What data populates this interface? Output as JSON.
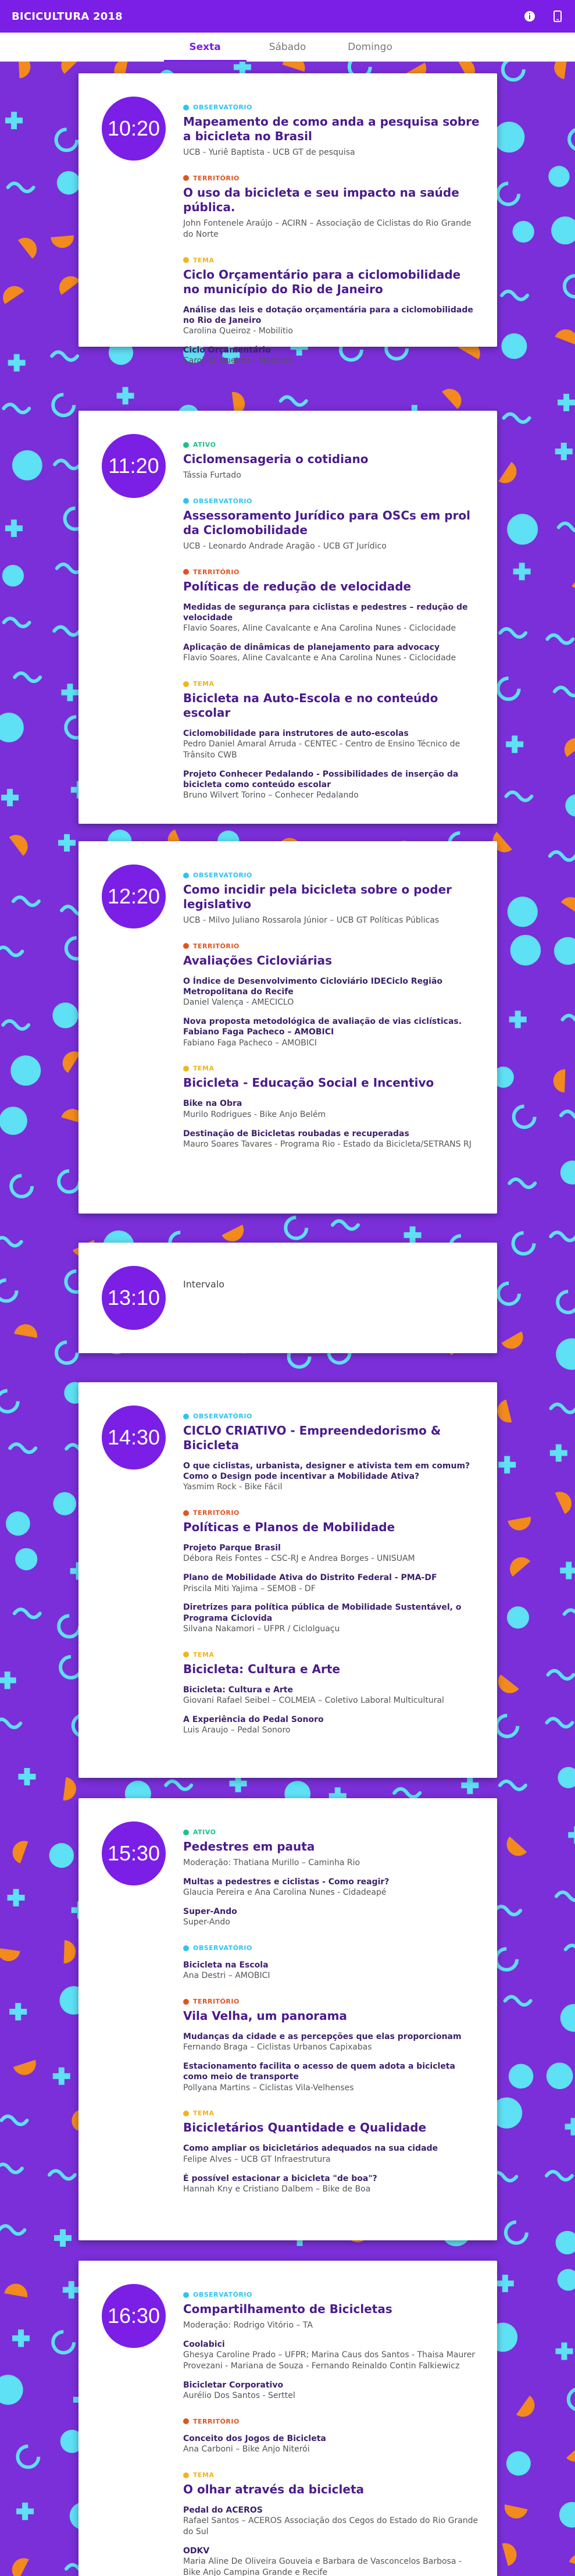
{
  "appbar": {
    "title": "BICICULTURA 2018",
    "info_icon": "info-icon",
    "phone_icon": "phone-icon"
  },
  "tabs": [
    "Sexta",
    "Sábado",
    "Domingo"
  ],
  "colors": {
    "primary": "#7b1ee6",
    "background": "#7a2fd8",
    "cyan": "#5ee0f5",
    "orange": "#f28a1d",
    "observatorio": "#2fc4f0",
    "ativo": "#19c28b",
    "territorio": "#e0541f",
    "tema": "#f2b41a"
  },
  "sessions": [
    {
      "time": "10:20",
      "slots": [
        {
          "type": "OBSERVATÓRIO",
          "title": "Mapeamento de como anda a pesquisa sobre a bicicleta no Brasil",
          "sub": "UCB - Yuriê Baptista - UCB GT de pesquisa",
          "talks": []
        },
        {
          "type": "TERRITÓRIO",
          "title": "O uso da bicicleta e seu impacto na saúde pública.",
          "sub": "John Fontenele Araújo – ACIRN – Associação de Ciclistas do Rio Grande do Norte",
          "talks": []
        },
        {
          "type": "TEMA",
          "title": "Ciclo Orçamentário para a ciclomobilidade no município do Rio de Janeiro",
          "sub": "",
          "talks": [
            {
              "title": "Análise das leis e dotação orçamentária para a ciclomobilidade no Rio de Janeiro",
              "author": "Carolina Queiroz - Mobilitio"
            },
            {
              "title": "Ciclo Orçamentário",
              "author": "Carolina Queiroz - Mobilitio"
            }
          ]
        }
      ]
    },
    {
      "time": "11:20",
      "slots": [
        {
          "type": "ATIVO",
          "title": "Ciclomensageria o cotidiano",
          "sub": "Tássia Furtado",
          "talks": []
        },
        {
          "type": "OBSERVATÓRIO",
          "title": "Assessoramento Jurídico para OSCs em prol da Ciclomobilidade",
          "sub": "UCB - Leonardo Andrade Aragão - UCB GT Jurídico",
          "talks": []
        },
        {
          "type": "TERRITÓRIO",
          "title": "Políticas de redução de velocidade",
          "sub": "",
          "talks": [
            {
              "title": "Medidas de segurança para ciclistas e pedestres – redução de velocidade",
              "author": "Flavio Soares, Aline Cavalcante e Ana Carolina Nunes - Ciclocidade"
            },
            {
              "title": "Aplicação de dinâmicas de planejamento para advocacy",
              "author": "Flavio Soares, Aline Cavalcante e Ana Carolina Nunes - Ciclocidade"
            }
          ]
        },
        {
          "type": "TEMA",
          "title": "Bicicleta na Auto-Escola e no conteúdo escolar",
          "sub": "",
          "talks": [
            {
              "title": "Ciclomobilidade para instrutores de auto-escolas",
              "author": "Pedro Daniel Amaral Arruda - CENTEC - Centro de Ensino Técnico de Trânsito CWB"
            },
            {
              "title": "Projeto Conhecer Pedalando - Possibilidades de inserção da bicicleta como conteúdo escolar",
              "author": "Bruno Wilvert Torino – Conhecer Pedalando"
            }
          ]
        }
      ]
    },
    {
      "time": "12:20",
      "slots": [
        {
          "type": "OBSERVATÓRIO",
          "title": "Como incidir pela bicicleta sobre o poder legislativo",
          "sub": "UCB - Milvo Juliano Rossarola Júnior – UCB GT Políticas Públicas",
          "talks": []
        },
        {
          "type": "TERRITÓRIO",
          "title": "Avaliações Cicloviárias",
          "sub": "",
          "talks": [
            {
              "title": "O Índice de Desenvolvimento Cicloviário IDECiclo Região Metropolitana do Recife",
              "author": "Daniel Valença - AMECICLO"
            },
            {
              "title": "Nova proposta metodológica de avaliação de vias ciclísticas. Fabiano Faga Pacheco – AMOBICI",
              "author": "Fabiano Faga Pacheco – AMOBICI"
            }
          ]
        },
        {
          "type": "TEMA",
          "title": "Bicicleta - Educação Social e Incentivo",
          "sub": "",
          "talks": [
            {
              "title": "Bike na Obra",
              "author": "Murilo Rodrigues - Bike Anjo Belém"
            },
            {
              "title": "Destinação de Bicicletas roubadas e recuperadas",
              "author": "Mauro Soares Tavares - Programa Rio - Estado da Bicicleta/SETRANS RJ"
            }
          ]
        }
      ]
    },
    {
      "time": "13:10",
      "intervalo": "Intervalo",
      "slots": []
    },
    {
      "time": "14:30",
      "slots": [
        {
          "type": "OBSERVATÓRIO",
          "title": "CICLO CRIATIVO - Empreendedorismo & Bicicleta",
          "sub": "",
          "talks": [
            {
              "title": "O que ciclistas, urbanista, designer e ativista tem em comum? Como o Design pode incentivar a Mobilidade Ativa?",
              "author": "Yasmim Rock - Bike Fácil"
            }
          ]
        },
        {
          "type": "TERRITÓRIO",
          "title": "Políticas e Planos de Mobilidade",
          "sub": "",
          "talks": [
            {
              "title": "Projeto Parque Brasil",
              "author": "Débora Reis Fontes – CSC-RJ e Andrea Borges - UNISUAM"
            },
            {
              "title": "Plano de Mobilidade Ativa do Distrito Federal - PMA-DF",
              "author": "Priscila Miti Yajima – SEMOB - DF"
            },
            {
              "title": "Diretrizes para política pública de Mobilidade Sustentável, o Programa Ciclovida",
              "author": "Silvana Nakamori – UFPR / Ciclolguaçu"
            }
          ]
        },
        {
          "type": "TEMA",
          "title": "Bicicleta: Cultura e Arte",
          "sub": "",
          "talks": [
            {
              "title": "Bicicleta: Cultura e Arte",
              "author": "Giovani Rafael Seibel – COLMEIA – Coletivo Laboral Multicultural"
            },
            {
              "title": "A Experiência do Pedal Sonoro",
              "author": "Luis Araujo – Pedal Sonoro"
            }
          ]
        }
      ]
    },
    {
      "time": "15:30",
      "slots": [
        {
          "type": "ATIVO",
          "title": "Pedestres em pauta",
          "sub": "Moderação: Thatiana Murillo – Caminha Rio",
          "talks": [
            {
              "title": "Multas a pedestres e ciclistas - Como reagir?",
              "author": "Glaucia Pereira e Ana Carolina Nunes - Cidadeapé"
            },
            {
              "title": "Super-Ando",
              "author": "Super-Ando"
            }
          ]
        },
        {
          "type": "OBSERVATÓRIO",
          "title": "",
          "sub": "",
          "talks": [
            {
              "title": "Bicicleta na Escola",
              "author": "Ana Destri – AMOBICI"
            }
          ]
        },
        {
          "type": "TERRITÓRIO",
          "title": "Vila Velha, um panorama",
          "sub": "",
          "talks": [
            {
              "title": "Mudanças da cidade e as percepções que elas proporcionam",
              "author": "Fernando Braga – Ciclistas Urbanos Capixabas"
            },
            {
              "title": "Estacionamento facilita o acesso de quem adota a bicicleta como meio de transporte",
              "author": "Pollyana Martins – Ciclistas Vila-Velhenses"
            }
          ]
        },
        {
          "type": "TEMA",
          "title": "Bicicletários Quantidade e Qualidade",
          "sub": "",
          "talks": [
            {
              "title": "Como ampliar os bicicletários adequados na sua cidade",
              "author": "Felipe Alves – UCB GT Infraestrutura"
            },
            {
              "title": "É possível estacionar a bicicleta \"de boa\"?",
              "author": "Hannah Kny e Cristiano Dalbem – Bike de Boa"
            }
          ]
        }
      ]
    },
    {
      "time": "16:30",
      "slots": [
        {
          "type": "OBSERVATÓRIO",
          "title": "Compartilhamento de Bicicletas",
          "sub": "Moderação: Rodrigo Vitório – TA",
          "talks": [
            {
              "title": "Coolabici",
              "author": "Ghesya Caroline Prado – UFPR; Marina Caus dos Santos - Thaisa Maurer Provezani - Mariana de Souza - Fernando Reinaldo Contin Falkiewicz"
            },
            {
              "title": "Bicicletar Corporativo",
              "author": "Aurélio Dos Santos - Serttel"
            }
          ]
        },
        {
          "type": "TERRITÓRIO",
          "title": "",
          "sub": "",
          "talks": [
            {
              "title": "Conceito dos Jogos de Bicicleta",
              "author": "Ana Carboni – Bike Anjo Niterói"
            }
          ]
        },
        {
          "type": "TEMA",
          "title": "O olhar através da bicicleta",
          "sub": "",
          "talks": [
            {
              "title": "Pedal do ACEROS",
              "author": "Rafael Santos – ACEROS Associação dos Cegos do Estado do Rio Grande do Sul"
            },
            {
              "title": "ODKV",
              "author": "Maria Aline De Oliveira Gouveia e Barbara de Vasconcelos Barbosa - Bike Anjo Campina Grande e Recife"
            }
          ]
        }
      ]
    }
  ]
}
